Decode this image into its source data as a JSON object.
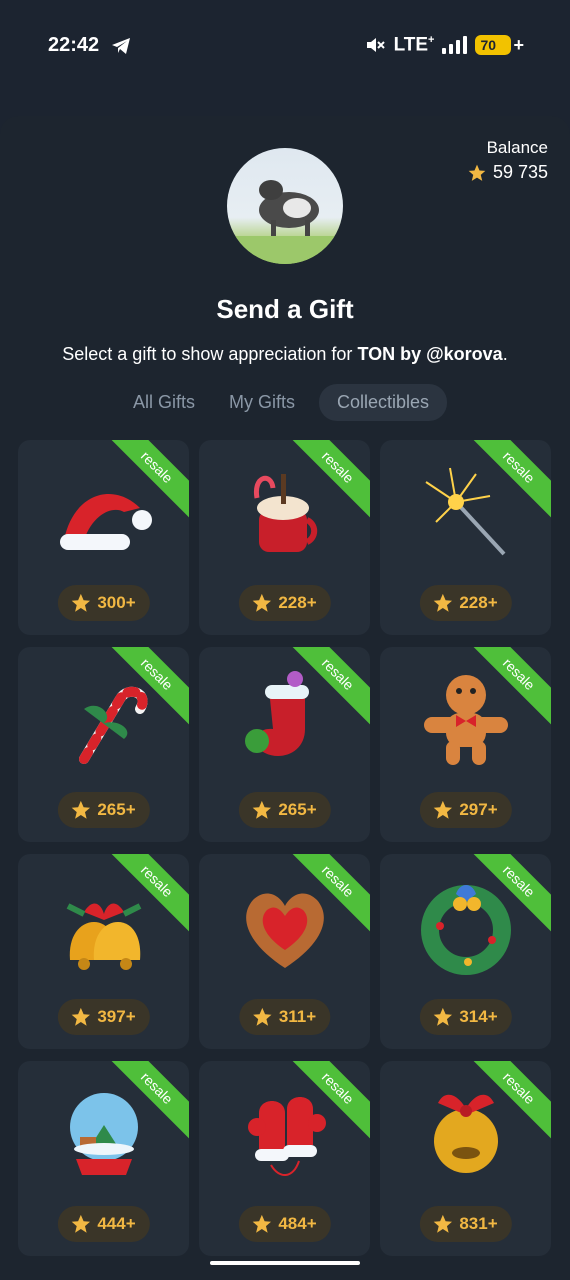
{
  "status": {
    "time": "22:42",
    "network": "LTE",
    "network_sup": "+",
    "battery": "70",
    "battery_plus": "+"
  },
  "balance": {
    "label": "Balance",
    "value": "59 735"
  },
  "header": {
    "title": "Send a Gift",
    "subtitle_prefix": "Select a gift to show appreciation for ",
    "subtitle_name": "TON by @korova",
    "subtitle_suffix": "."
  },
  "tabs": [
    {
      "label": "All Gifts",
      "active": false
    },
    {
      "label": "My Gifts",
      "active": false
    },
    {
      "label": "Collectibles",
      "active": true
    }
  ],
  "gifts": [
    {
      "icon": "santa-hat-icon",
      "ribbon": "resale",
      "price": "300+"
    },
    {
      "icon": "hot-cocoa-icon",
      "ribbon": "resale",
      "price": "228+"
    },
    {
      "icon": "sparkler-icon",
      "ribbon": "resale",
      "price": "228+"
    },
    {
      "icon": "candy-cane-icon",
      "ribbon": "resale",
      "price": "265+"
    },
    {
      "icon": "christmas-stocking-icon",
      "ribbon": "resale",
      "price": "265+"
    },
    {
      "icon": "gingerbread-man-icon",
      "ribbon": "resale",
      "price": "297+"
    },
    {
      "icon": "jingle-bells-icon",
      "ribbon": "resale",
      "price": "397+"
    },
    {
      "icon": "heart-cookie-icon",
      "ribbon": "resale",
      "price": "311+"
    },
    {
      "icon": "christmas-wreath-icon",
      "ribbon": "resale",
      "price": "314+"
    },
    {
      "icon": "snow-globe-icon",
      "ribbon": "resale",
      "price": "444+"
    },
    {
      "icon": "mittens-icon",
      "ribbon": "resale",
      "price": "484+"
    },
    {
      "icon": "golden-bell-icon",
      "ribbon": "resale",
      "price": "831+"
    }
  ],
  "colors": {
    "background": "#1c2430",
    "card": "#252e39",
    "ribbon": "#4fbf3a",
    "star": "#f2b843"
  }
}
